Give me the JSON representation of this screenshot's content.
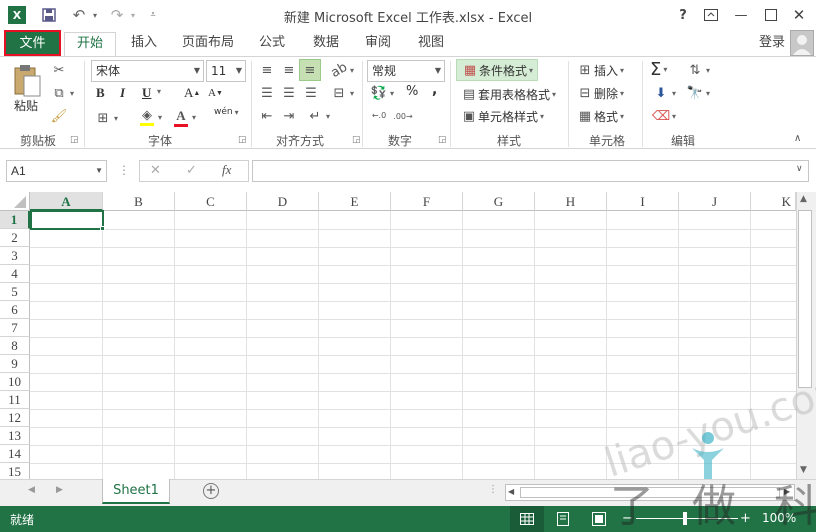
{
  "title_bar": {
    "title": "新建 Microsoft Excel 工作表.xlsx - Excel",
    "help": "?",
    "login": "登录"
  },
  "tabs": [
    {
      "label": "文件"
    },
    {
      "label": "开始"
    },
    {
      "label": "插入"
    },
    {
      "label": "页面布局"
    },
    {
      "label": "公式"
    },
    {
      "label": "数据"
    },
    {
      "label": "审阅"
    },
    {
      "label": "视图"
    }
  ],
  "ribbon": {
    "clipboard": {
      "paste": "粘贴",
      "label": "剪贴板"
    },
    "font": {
      "name": "宋体",
      "size": "11",
      "label": "字体",
      "bold": "B",
      "italic": "I",
      "underline": "U",
      "grow": "A",
      "shrink": "A",
      "phonetic": "wén"
    },
    "alignment": {
      "label": "对齐方式"
    },
    "number": {
      "format": "常规",
      "label": "数字",
      "percent": "%",
      "comma": ","
    },
    "styles": {
      "conditional": "条件格式",
      "table": "套用表格格式",
      "cell": "单元格样式",
      "label": "样式"
    },
    "cells": {
      "insert": "插入",
      "delete": "删除",
      "format": "格式",
      "label": "单元格"
    },
    "editing": {
      "label": "编辑",
      "sum": "Σ"
    }
  },
  "formula_bar": {
    "name_box": "A1",
    "fx": "fx",
    "formula": ""
  },
  "grid": {
    "columns": [
      "A",
      "B",
      "C",
      "D",
      "E",
      "F",
      "G",
      "H",
      "I",
      "J",
      "K"
    ],
    "rows": [
      "1",
      "2",
      "3",
      "4",
      "5",
      "6",
      "7",
      "8",
      "9",
      "10",
      "11",
      "12",
      "13",
      "14",
      "15"
    ],
    "active_cell": "A1"
  },
  "sheets": [
    {
      "name": "Sheet1"
    }
  ],
  "status": {
    "ready": "就绪",
    "zoom": "100%"
  },
  "watermark": {
    "url": "liao-you.com",
    "text": "了 做 科 技"
  },
  "colors": {
    "accent": "#217346",
    "highlight": "#e81123"
  }
}
